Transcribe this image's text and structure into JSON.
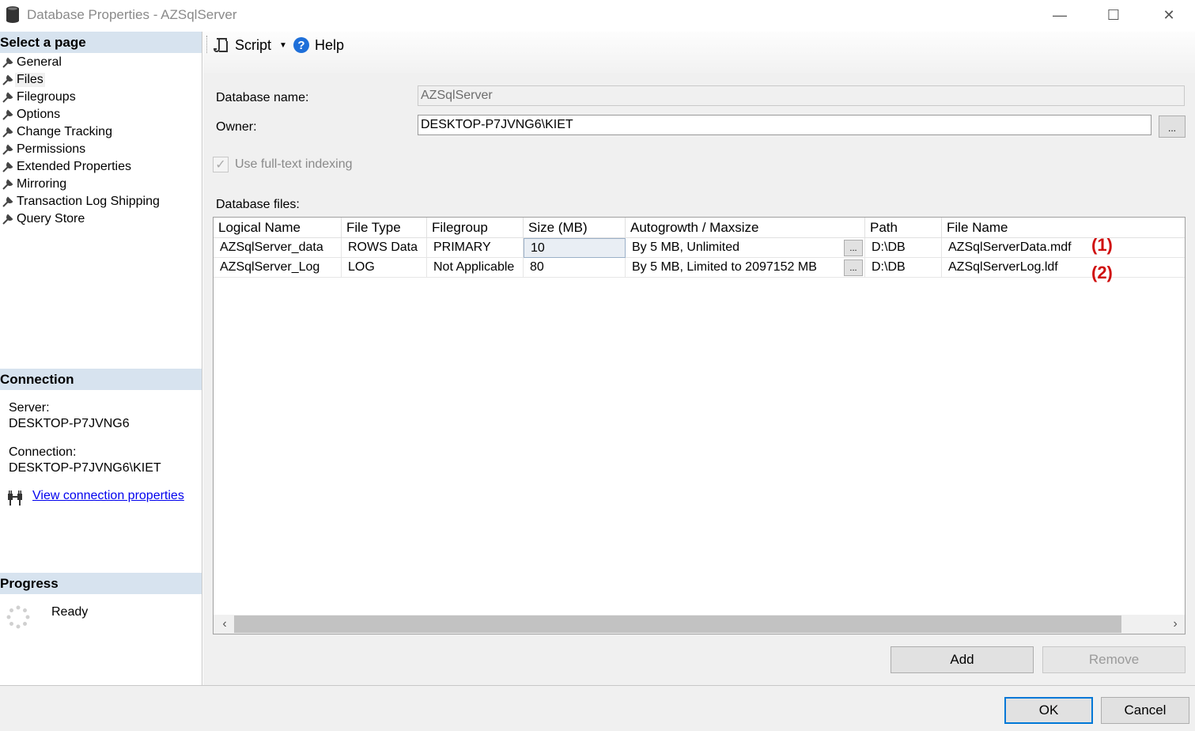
{
  "window": {
    "title": "Database Properties - AZSqlServer",
    "minimize": "—",
    "maximize": "☐",
    "close": "✕"
  },
  "sidebar": {
    "select_page_header": "Select a page",
    "items": [
      {
        "label": "General"
      },
      {
        "label": "Files"
      },
      {
        "label": "Filegroups"
      },
      {
        "label": "Options"
      },
      {
        "label": "Change Tracking"
      },
      {
        "label": "Permissions"
      },
      {
        "label": "Extended Properties"
      },
      {
        "label": "Mirroring"
      },
      {
        "label": "Transaction Log Shipping"
      },
      {
        "label": "Query Store"
      }
    ],
    "connection_header": "Connection",
    "server_label": "Server:",
    "server_value": "DESKTOP-P7JVNG6",
    "connection_label": "Connection:",
    "connection_value": "DESKTOP-P7JVNG6\\KIET",
    "view_connection_link": "View connection properties",
    "progress_header": "Progress",
    "progress_status": "Ready"
  },
  "toolbar": {
    "script_label": "Script",
    "help_label": "Help"
  },
  "form": {
    "database_name_label": "Database name:",
    "database_name_value": "AZSqlServer",
    "owner_label": "Owner:",
    "owner_value": "DESKTOP-P7JVNG6\\KIET",
    "browse_label": "...",
    "fulltext_label": "Use full-text indexing",
    "database_files_label": "Database files:"
  },
  "grid": {
    "columns": [
      "Logical Name",
      "File Type",
      "Filegroup",
      "Size (MB)",
      "Autogrowth / Maxsize",
      "Path",
      "File Name"
    ],
    "rows": [
      {
        "logical_name": "AZSqlServer_data",
        "file_type": "ROWS Data",
        "filegroup": "PRIMARY",
        "size": "10",
        "autogrowth": "By 5 MB, Unlimited",
        "path": "D:\\DB",
        "file_name": "AZSqlServerData.mdf",
        "annotation": "(1)"
      },
      {
        "logical_name": "AZSqlServer_Log",
        "file_type": "LOG",
        "filegroup": "Not Applicable",
        "size": "80",
        "autogrowth": "By 5 MB, Limited to 2097152 MB",
        "path": "D:\\DB",
        "file_name": "AZSqlServerLog.ldf",
        "annotation": "(2)"
      }
    ],
    "ellipsis": "..."
  },
  "buttons": {
    "add": "Add",
    "remove": "Remove",
    "ok": "OK",
    "cancel": "Cancel"
  },
  "colors": {
    "section_header_bg": "#d7e3ef",
    "annotation_red": "#d01010",
    "link_blue": "#0000ee",
    "help_icon_blue": "#1e6fd9",
    "default_button_border": "#0078d7"
  }
}
